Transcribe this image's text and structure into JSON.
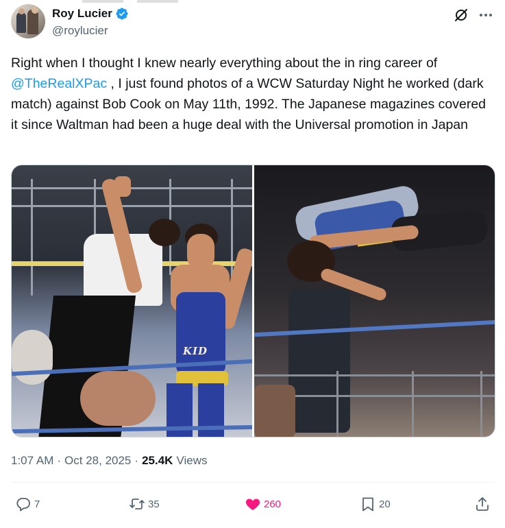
{
  "author": {
    "display_name": "Roy Lucier",
    "handle": "@roylucier",
    "verified": true
  },
  "tweet": {
    "text_before": "Right when I thought I knew nearly everything about the in ring career of ",
    "mention": "@TheRealXPac",
    "text_after": " , I just found photos of a WCW Saturday Night he worked (dark match) against Bob Cook on May 11th, 1992. The Japanese magazines covered it since Waltman had been a huge deal with the Universal promotion in Japan"
  },
  "media": {
    "left_photo_text": "KID"
  },
  "meta": {
    "time": "1:07 AM",
    "separator": "·",
    "date": "Oct 28, 2025",
    "views_count": "25.4K",
    "views_label": "Views"
  },
  "actions": {
    "replies": "7",
    "reposts": "35",
    "likes": "260",
    "bookmarks": "20"
  },
  "colors": {
    "accent": "#1d9bf0",
    "like": "#f91880",
    "secondary_text": "#536471"
  },
  "icons": [
    "verified-badge-icon",
    "grok-icon",
    "more-icon",
    "reply-icon",
    "repost-icon",
    "like-icon",
    "bookmark-icon",
    "share-icon"
  ]
}
